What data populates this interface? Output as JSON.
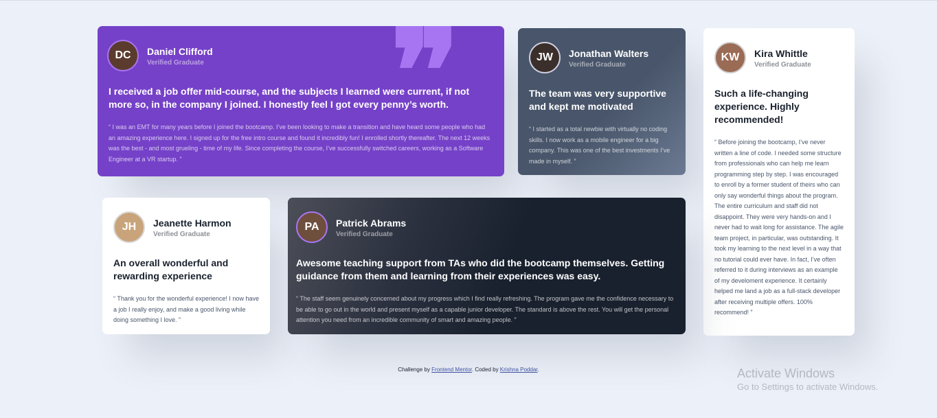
{
  "testimonials": {
    "daniel": {
      "initials": "DC",
      "name": "Daniel Clifford",
      "role": "Verified Graduate",
      "headline": "I received a job offer mid-course, and the subjects I learned were current, if not more so, in the company I joined. I honestly feel I got every penny’s worth.",
      "body": "“ I was an EMT for many years before I joined the bootcamp. I’ve been looking to make a transition and have heard some people who had an amazing experience here. I signed up for the free intro course and found it incredibly fun! I enrolled shortly thereafter. The next 12 weeks was the best - and most grueling - time of my life. Since completing the course, I’ve successfully switched careers, working as a Software Engineer at a VR startup. ”"
    },
    "jonathan": {
      "initials": "JW",
      "name": "Jonathan Walters",
      "role": "Verified Graduate",
      "headline": "The team was very supportive and kept me motivated",
      "body": "“ I started as a total newbie with virtually no coding skills. I now work as a mobile engineer for a big company. This was one of the best investments I’ve made in myself. ”"
    },
    "kira": {
      "initials": "KW",
      "name": "Kira Whittle",
      "role": "Verified Graduate",
      "headline": "Such a life-changing experience. Highly recommended!",
      "body": "“ Before joining the bootcamp, I’ve never written a line of code. I needed some structure from professionals who can help me learn programming step by step. I was encouraged to enroll by a former student of theirs who can only say wonderful things about the program. The entire curriculum and staff did not disappoint. They were very hands-on and I never had to wait long for assistance. The agile team project, in particular, was outstanding. It took my learning to the next level in a way that no tutorial could ever have. In fact, I’ve often referred to it during interviews as an example of my develoment experience. It certainly helped me land a job as a full-stack developer after receiving multiple offers. 100% recommend! ”"
    },
    "jeanette": {
      "initials": "JH",
      "name": "Jeanette Harmon",
      "role": "Verified Graduate",
      "headline": "An overall wonderful and rewarding experience",
      "body": "“ Thank you for the wonderful experience! I now have a job I really enjoy, and make a good living while doing something I love. ”"
    },
    "patrick": {
      "initials": "PA",
      "name": "Patrick Abrams",
      "role": "Verified Graduate",
      "headline": "Awesome teaching support from TAs who did the bootcamp themselves. Getting guidance from them and learning from their experiences was easy.",
      "body": "“ The staff seem genuinely concerned about my progress which I find really refreshing. The program gave me the confidence necessary to be able to go out in the world and present myself as a capable junior developer. The standard is above the rest. You will get the personal attention you need from an incredible community of smart and amazing people. ”"
    }
  },
  "footer": {
    "prefix": "Challenge by ",
    "link1": "Frontend Mentor",
    "middle": ". Coded by ",
    "link2": "Krishna Poddar",
    "suffix": "."
  },
  "watermark": {
    "title": "Activate Windows",
    "subtitle": "Go to Settings to activate Windows."
  },
  "colors": {
    "background": "#ecf0f8",
    "purple": "#7541c8",
    "grayblue": "#48556a",
    "darkblue": "#19212e",
    "quote": "#a775f1"
  },
  "icons": {
    "quote": "quotation-mark-icon"
  }
}
